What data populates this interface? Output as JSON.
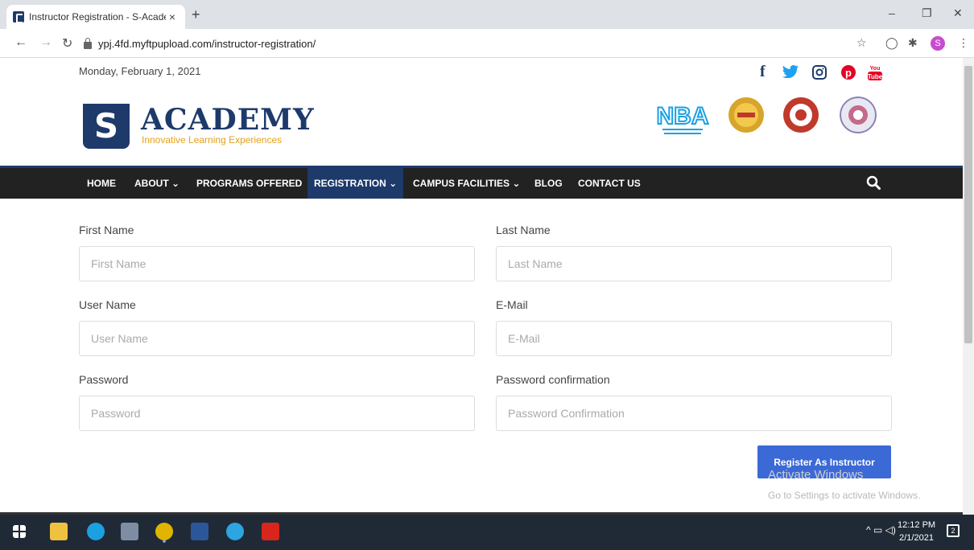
{
  "browser": {
    "tab_title": "Instructor Registration - S-Acade",
    "tab_close": "×",
    "new_tab": "+",
    "url": "ypj.4fd.myftpupload.com/instructor-registration/",
    "profile_initial": "S",
    "window_controls": [
      "–",
      "❐",
      "✕"
    ]
  },
  "header": {
    "date": "Monday, February 1, 2021",
    "social": [
      {
        "icon": "facebook-icon",
        "glyph": "f",
        "color": "#1d3a6b"
      },
      {
        "icon": "twitter-icon",
        "glyph": "🐦",
        "color": "#1da1f2"
      },
      {
        "icon": "instagram-icon",
        "glyph": "◎",
        "color": "#1d3a6b"
      },
      {
        "icon": "pinterest-icon",
        "glyph": "℗",
        "color": "#e60023"
      },
      {
        "icon": "youtube-icon",
        "glyph": "You Tube",
        "color": "#e60023"
      }
    ],
    "logo_letter": "S",
    "logo_name": "ACADEMY",
    "logo_tagline": "Innovative Learning Experiences",
    "accreditation_badges": [
      "nba-logo",
      "aicte-logo",
      "university-seal-logo",
      "institution-seal-logo"
    ],
    "nba_label": "NBA"
  },
  "nav": {
    "items": [
      {
        "label": "HOME",
        "dropdown": false,
        "active": false
      },
      {
        "label": "ABOUT",
        "dropdown": true,
        "active": false
      },
      {
        "label": "PROGRAMS OFFERED",
        "dropdown": false,
        "active": false
      },
      {
        "label": "REGISTRATION",
        "dropdown": true,
        "active": true
      },
      {
        "label": "CAMPUS FACILITIES",
        "dropdown": true,
        "active": false
      },
      {
        "label": "BLOG",
        "dropdown": false,
        "active": false
      },
      {
        "label": "CONTACT US",
        "dropdown": false,
        "active": false
      }
    ]
  },
  "form": {
    "first_name_label": "First Name",
    "first_name_placeholder": "First Name",
    "last_name_label": "Last Name",
    "last_name_placeholder": "Last Name",
    "user_name_label": "User Name",
    "user_name_placeholder": "User Name",
    "email_label": "E-Mail",
    "email_placeholder": "E-Mail",
    "password_label": "Password",
    "password_placeholder": "Password",
    "password_confirm_label": "Password confirmation",
    "password_confirm_placeholder": "Password Confirmation",
    "submit_label": "Register As Instructor"
  },
  "watermark": {
    "line1": "Activate Windows",
    "line2": "Go to Settings to activate Windows."
  },
  "taskbar": {
    "time": "12:12 PM",
    "date": "2/1/2021",
    "notification_count": "2",
    "colors": {
      "edge": "#1ba1e2",
      "chrome": "#e0b400",
      "word": "#2b579a",
      "telegram": "#2ca5e0",
      "acrobat": "#d9261c",
      "explorer": "#f0c040"
    }
  },
  "colors": {
    "brand": "#1d3a6b",
    "accent": "#3b69d6",
    "logo_tagline": "#e3a21a"
  }
}
